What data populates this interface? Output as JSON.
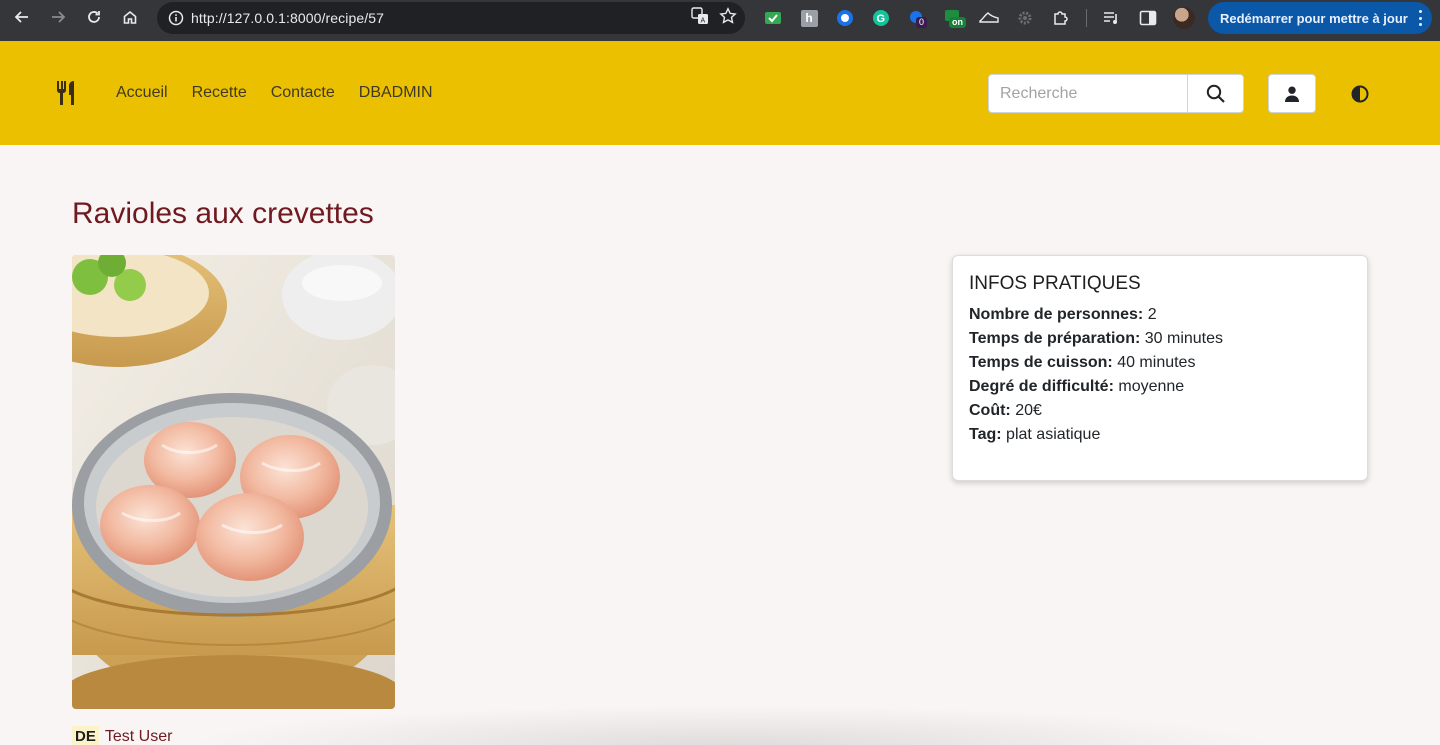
{
  "browser": {
    "url": "http://127.0.0.1:8000/recipe/57",
    "update_label": "Redémarrer pour mettre à jour",
    "extensions": [
      "mail-check-icon",
      "letter-icon",
      "compass-icon",
      "grammarly-icon",
      "counter-icon",
      "toggle-on-icon",
      "sneaker-icon",
      "gear-icon",
      "puzzle-icon"
    ],
    "ext_badges": {
      "counter": "0",
      "toggle": "on"
    }
  },
  "navbar": {
    "brand_icon": "utensils-icon",
    "links": [
      "Accueil",
      "Recette",
      "Contacte",
      "DBADMIN"
    ],
    "search_placeholder": "Recherche",
    "bg_color": "#ebc000"
  },
  "recipe": {
    "title": "Ravioles aux crevettes",
    "image_alt": "Ravioles aux crevettes dans un panier vapeur en bambou",
    "infos": {
      "heading": "INFOS PRATIQUES",
      "rows": [
        {
          "label": "Nombre de personnes:",
          "value": "2"
        },
        {
          "label": "Temps de préparation:",
          "value": "30 minutes"
        },
        {
          "label": "Temps de cuisson:",
          "value": "40 minutes"
        },
        {
          "label": "Degré de difficulté:",
          "value": "moyenne"
        },
        {
          "label": "Coût:",
          "value": "20€"
        },
        {
          "label": "Tag:",
          "value": "plat asiatique"
        }
      ]
    },
    "author": {
      "initials": "DE",
      "name": "Test User"
    }
  },
  "colors": {
    "title": "#6f1a20",
    "accent": "#ebc000",
    "update_button": "#0b57a8"
  }
}
